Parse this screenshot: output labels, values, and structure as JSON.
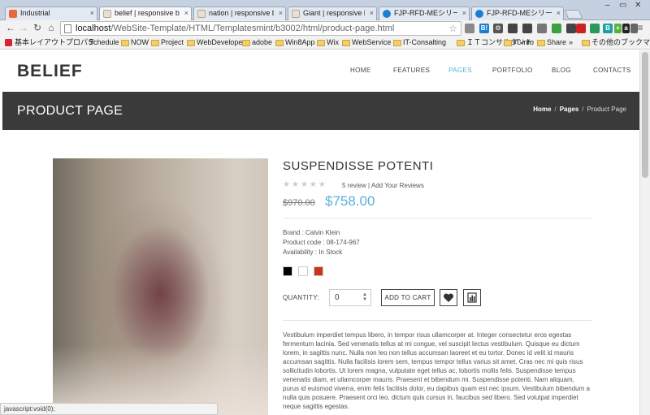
{
  "browser": {
    "tabs": [
      {
        "label": "Industrial",
        "favicon_color": "#e8683a"
      },
      {
        "label": "belief | responsive boot",
        "favicon_color": "#e9e0d4"
      },
      {
        "label": "nation | responsive boot",
        "favicon_color": "#e9e0d4"
      },
      {
        "label": "Giant | responsive boot",
        "favicon_color": "#e9e0d4"
      },
      {
        "label": "FJP-RFD-MEシリーズ【従来",
        "favicon_color": "#1a7fd1"
      },
      {
        "label": "FJP-RFD-MEシリーズ【従来",
        "favicon_color": "#1a7fd1"
      }
    ],
    "close_glyph": "×",
    "window_controls": [
      "–",
      "▭",
      "✕"
    ],
    "nav_icons": [
      "arrow-left-icon",
      "arrow-right-icon",
      "reload-icon",
      "home-icon"
    ],
    "url_host": "localhost",
    "url_path": "/WebSite-Template/HTML/Templatesmint/b3002/html/product-page.html",
    "ext_icons": [
      {
        "name": "ext-grey-icon",
        "color": "#8a8a8a",
        "text": ""
      },
      {
        "name": "hatena-bookmark-icon",
        "color": "#1a7fd1",
        "text": "B!"
      },
      {
        "name": "ext-gear-icon",
        "color": "#555555",
        "text": "⚙"
      },
      {
        "name": "ext-puzzle-icon",
        "color": "#444444",
        "text": ""
      },
      {
        "name": "ext-fish-icon",
        "color": "#444444",
        "text": ""
      },
      {
        "name": "ext-doc-icon",
        "color": "#777777",
        "text": ""
      },
      {
        "name": "ext-green-icon",
        "color": "#3aa040",
        "text": ""
      },
      {
        "name": "ext-lock-icon",
        "color": "#444444",
        "text": ""
      },
      {
        "name": "ext-stop-icon",
        "color": "#cc2222",
        "text": ""
      },
      {
        "name": "ext-shield-icon",
        "color": "#2a9a5a",
        "text": ""
      },
      {
        "name": "ext-b-icon",
        "color": "#1aa0a0",
        "text": "B"
      },
      {
        "name": "ext-plus-icon",
        "color": "#5ab040",
        "text": "+"
      },
      {
        "name": "ext-amazon-icon",
        "color": "#222222",
        "text": "a"
      },
      {
        "name": "ext-shield2-icon",
        "color": "#666666",
        "text": ""
      }
    ],
    "bookmarks": [
      {
        "label": "基本レイアウトプロパテ",
        "icon": "adobe"
      },
      {
        "label": "Schedule",
        "icon": "apple"
      },
      {
        "label": "NOW",
        "icon": "folder"
      },
      {
        "label": "Project",
        "icon": "folder"
      },
      {
        "label": "WebDeveloper",
        "icon": "folder"
      },
      {
        "label": "adobe",
        "icon": "folder"
      },
      {
        "label": "Win8App",
        "icon": "folder"
      },
      {
        "label": "Wix",
        "icon": "folder"
      },
      {
        "label": "WebService",
        "icon": "folder"
      },
      {
        "label": "IT-Consalting",
        "icon": "folder"
      },
      {
        "label": "ＩＴコンサルタント",
        "icon": "folder"
      },
      {
        "label": "IT-info",
        "icon": "folder"
      },
      {
        "label": "Share",
        "icon": "folder"
      }
    ],
    "bookmarks_more": "»",
    "other_bookmarks": "その他のブックマーク",
    "status_text": "javascript:void(0);"
  },
  "site": {
    "logo": "BELIEF",
    "nav": [
      {
        "label": "HOME",
        "active": false
      },
      {
        "label": "FEATURES",
        "active": false
      },
      {
        "label": "PAGES",
        "active": true
      },
      {
        "label": "PORTFOLIO",
        "active": false
      },
      {
        "label": "BLOG",
        "active": false
      },
      {
        "label": "CONTACTS",
        "active": false
      }
    ],
    "accent": "#5ab0d8",
    "page_title": "PRODUCT PAGE",
    "breadcrumb": {
      "home": "Home",
      "sep": "/",
      "pages": "Pages",
      "current": "Product Page"
    }
  },
  "product": {
    "title": "SUSPENDISSE POTENTI",
    "stars_total": 5,
    "stars_filled": 0,
    "review_count": "5 review",
    "review_sep": "|",
    "add_review": "Add Your Reviews",
    "old_price": "$970.00",
    "new_price": "$758.00",
    "brand": "Brand : Calvin Klein",
    "code": "Product code : 08-174-967",
    "availability": "Availability : In Stock",
    "colors": [
      "#000000",
      "#ffffff",
      "#c8361c"
    ],
    "quantity_label": "QUANTITY:",
    "quantity": "0",
    "add_to_cart": "ADD TO CART",
    "description": "Vestibulum imperdiet tempus libero, in tempor risus ullamcorper at. Integer consectetur eros egestas fermentum lacinia. Sed venenatis tellus at mi congue, vel suscipit lectus vestibulum. Quisque eu dictum lorem, in sagittis nunc. Nulla non leo non tellus accumsan laoreet et eu tortor. Donec id velit id mauris accumsan sagittis. Nulla facilisis lorem sem, tempus tempor tellus varius sit amet. Cras nec mi quis risus sollicitudin lobortis. Ut lorem magna, vulputate eget tellus ac, lobortis mollis felis. Suspendisse tempus venenatis diam, et ullamcorper mauris. Praesent et bibendum mi. Suspendisse potenti. Nam aliquam, purus id euismod viverra, enim felis facilisis dolor, eu dapibus quam est nec ipsum. Vestibulum bibendum a nulla quis posuere. Praesent orci leo, dictum quis cursus in, faucibus sed libero. Sed volutpat imperdiet neque sagittis egestas."
  }
}
